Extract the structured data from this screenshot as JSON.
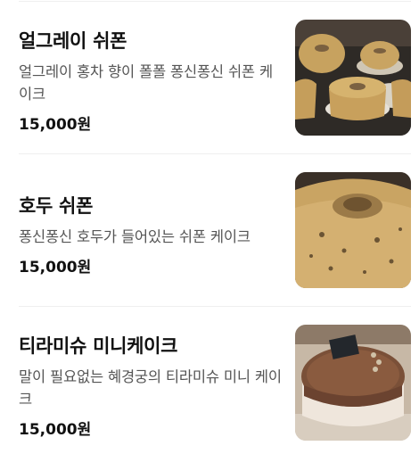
{
  "menu": {
    "items": [
      {
        "name": "얼그레이 쉬폰",
        "description": "얼그레이 홍차 향이 폴폴 퐁신퐁신 쉬폰 케이크",
        "price": "15,000원",
        "image": "earl-grey-chiffon-cake-photo"
      },
      {
        "name": "호두 쉬폰",
        "description": "퐁신퐁신 호두가 들어있는 쉬폰 케이크",
        "price": "15,000원",
        "image": "walnut-chiffon-cake-photo"
      },
      {
        "name": "티라미슈 미니케이크",
        "description": "말이 필요없는 혜경궁의 티라미슈 미니 케이크",
        "price": "15,000원",
        "image": "tiramisu-mini-cake-photo"
      }
    ]
  },
  "colors": {
    "text_primary": "#111111",
    "text_secondary": "#555555",
    "divider": "#efefef"
  }
}
